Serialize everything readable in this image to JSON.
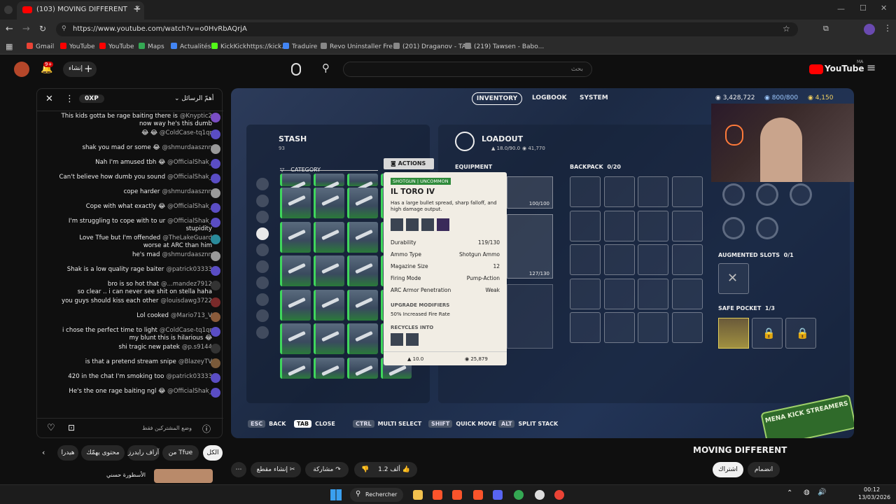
{
  "browser": {
    "tab_title": "(103) MOVING DIFFERENT",
    "url": "https://www.youtube.com/watch?v=o0HvRbAQrjA",
    "bookmarks": [
      "Gmail",
      "YouTube",
      "YouTube",
      "Maps",
      "Actualités",
      "KickKickhttps://kick...",
      "Traduire",
      "Revo Uninstaller Fre...",
      "(201) Draganov - TA...",
      "(219) Tawsen - Babo..."
    ]
  },
  "youtube": {
    "notif_count": "9+",
    "create_label": "إنشاء",
    "search_placeholder": "بحث",
    "logo": "YouTube",
    "region": "MA"
  },
  "chat": {
    "points": "0XP",
    "sort_label": "أهمّ الرسائل",
    "subscribers_only": "وضع المشتركين فقط",
    "messages": [
      {
        "text": "This kids gotta be rage baiting there is",
        "user": "@Knyptic2",
        "text2": "now way he's this dumb"
      },
      {
        "text": "😂 😂",
        "user": "@ColdCase-tq1qr"
      },
      {
        "text": "shak you mad or some 😂",
        "user": "@shmurdaasznn"
      },
      {
        "text": "Nah I'm amused tbh 😂",
        "user": "@OfficialShak_"
      },
      {
        "text": "Can't believe how dumb you sound",
        "user": "@OfficialShak_"
      },
      {
        "text": "cope harder",
        "user": "@shmurdaasznn"
      },
      {
        "text": "Cope with what exactly 😂",
        "user": "@OfficialShak_"
      },
      {
        "text": "I'm struggling to cope with to ur",
        "user": "@OfficialShak_",
        "text2": "stupidity"
      },
      {
        "text": "Love Tfue but I'm offended",
        "user": "@TheLakeGuard",
        "text2": "worse at ARC than him"
      },
      {
        "text": "he's mad",
        "user": "@shmurdaasznn"
      },
      {
        "text": "Shak is a low quality rage baiter",
        "user": "@patrick03333"
      },
      {
        "text": "bro is so hot that",
        "user": "@...mandez7912",
        "text2": "so clear .. i can never see shit on stella haha"
      },
      {
        "text": "you guys should kiss each other",
        "user": "@louisdawg3722"
      },
      {
        "text": "Lol cooked",
        "user": "@Mario713_V"
      },
      {
        "text": "i chose the perfect time to light",
        "user": "@ColdCase-tq1qr",
        "text2": "my blunt this is hilarious 😂"
      },
      {
        "text": "shi tragic new patek",
        "user": "@p.s9144"
      },
      {
        "text": "is that a pretend stream snipe",
        "user": "@BlazeyTV"
      },
      {
        "text": "420 in the chat I'm smoking too",
        "user": "@patrick03333"
      },
      {
        "text": "He's the one rage baiting ngl 😂",
        "user": "@OfficialShak_"
      }
    ]
  },
  "game": {
    "tabs": [
      "INVENTORY",
      "LOGBOOK",
      "SYSTEM"
    ],
    "currency1": "3,428,722",
    "currency2": "800/800",
    "currency3": "4,150",
    "stash_title": "STASH",
    "stash_count": "93",
    "category_label": "CATEGORY",
    "actions_label": "ACTIONS",
    "loadout_title": "LOADOUT",
    "loadout_weight": "18.0/90.0",
    "loadout_value": "41,770",
    "equipment_label": "EQUIPMENT",
    "backpack_label": "BACKPACK",
    "backpack_count": "0/20",
    "slot1_count": "100/100",
    "slot2_count": "127/130",
    "augmented_label": "AUGMENTED SLOTS",
    "augmented_count": "0/1",
    "safe_pocket_label": "SAFE POCKET",
    "safe_pocket_count": "1/3",
    "keys": [
      {
        "key": "ESC",
        "label": "BACK"
      },
      {
        "key": "TAB",
        "label": "CLOSE"
      },
      {
        "key": "CTRL",
        "label": "MULTI SELECT"
      },
      {
        "key": "SHIFT",
        "label": "QUICK MOVE"
      },
      {
        "key": "ALT",
        "label": "SPLIT STACK"
      }
    ],
    "tooltip": {
      "type": "SHOTGUN",
      "rarity": "UNCOMMON",
      "name": "IL TORO IV",
      "desc": "Has a large bullet spread, sharp falloff, and high damage output.",
      "stats": [
        {
          "k": "Durability",
          "v": "119/130"
        },
        {
          "k": "Ammo Type",
          "v": "Shotgun Ammo"
        },
        {
          "k": "Magazine Size",
          "v": "12"
        },
        {
          "k": "Firing Mode",
          "v": "Pump-Action"
        },
        {
          "k": "ARC Armor Penetration",
          "v": "Weak"
        }
      ],
      "upgrade_title": "UPGRADE MODIFIERS",
      "upgrade_text": "50% Increased Fire Rate",
      "recycles_title": "RECYCLES INTO",
      "weight": "10.0",
      "value": "25,879"
    },
    "watermark": "MENA KICK STREAMERS"
  },
  "below": {
    "video_title": "MOVING DIFFERENT",
    "subscribe": "اشتراك",
    "join": "انضمام",
    "likes": "1.2 ألف",
    "share": "مشاركة",
    "clip": "إنشاء مقطع",
    "channel_tabs": [
      "الكل",
      "من Tfue",
      "آزاف رايدرز",
      "محتوى يهمّك",
      "هيدرا"
    ],
    "related_title": "الأسطورة حسني"
  },
  "taskbar": {
    "search": "Rechercher",
    "time": "00:12",
    "date": "13/03/2026"
  }
}
